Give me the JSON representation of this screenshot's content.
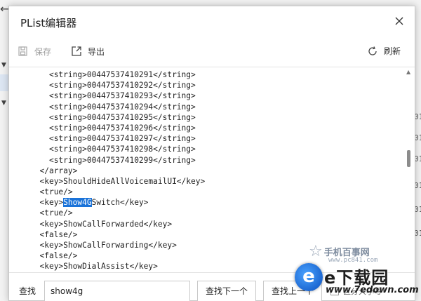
{
  "dialog": {
    "title": "PList编辑器"
  },
  "toolbar": {
    "save_label": "保存",
    "export_label": "导出",
    "refresh_label": "刷新"
  },
  "editor": {
    "lines": [
      {
        "indent": "    ",
        "pre": "<string>00447537410291</string>",
        "hl": "",
        "post": ""
      },
      {
        "indent": "    ",
        "pre": "<string>00447537410292</string>",
        "hl": "",
        "post": ""
      },
      {
        "indent": "    ",
        "pre": "<string>00447537410293</string>",
        "hl": "",
        "post": ""
      },
      {
        "indent": "    ",
        "pre": "<string>00447537410294</string>",
        "hl": "",
        "post": ""
      },
      {
        "indent": "    ",
        "pre": "<string>00447537410295</string>",
        "hl": "",
        "post": ""
      },
      {
        "indent": "    ",
        "pre": "<string>00447537410296</string>",
        "hl": "",
        "post": ""
      },
      {
        "indent": "    ",
        "pre": "<string>00447537410297</string>",
        "hl": "",
        "post": ""
      },
      {
        "indent": "    ",
        "pre": "<string>00447537410298</string>",
        "hl": "",
        "post": ""
      },
      {
        "indent": "    ",
        "pre": "<string>00447537410299</string>",
        "hl": "",
        "post": ""
      },
      {
        "indent": "  ",
        "pre": "</array>",
        "hl": "",
        "post": ""
      },
      {
        "indent": "  ",
        "pre": "<key>ShouldHideAllVoicemailUI</key>",
        "hl": "",
        "post": ""
      },
      {
        "indent": "  ",
        "pre": "<true/>",
        "hl": "",
        "post": ""
      },
      {
        "indent": "  ",
        "pre": "<key>",
        "hl": "Show4G",
        "post": "Switch</key>"
      },
      {
        "indent": "  ",
        "pre": "<true/>",
        "hl": "",
        "post": ""
      },
      {
        "indent": "  ",
        "pre": "<key>ShowCallForwarded</key>",
        "hl": "",
        "post": ""
      },
      {
        "indent": "  ",
        "pre": "<false/>",
        "hl": "",
        "post": ""
      },
      {
        "indent": "  ",
        "pre": "<key>ShowCallForwarding</key>",
        "hl": "",
        "post": ""
      },
      {
        "indent": "  ",
        "pre": "<false/>",
        "hl": "",
        "post": ""
      },
      {
        "indent": "  ",
        "pre": "<key>ShowDialAssist</key>",
        "hl": "",
        "post": ""
      }
    ]
  },
  "find": {
    "label": "查找",
    "value": "show4g",
    "next_label": "查找下一个",
    "prev_label": "查找上一个",
    "case_label": "区分大小写"
  },
  "background": {
    "right_glyphs": [
      "01",
      "01",
      "01",
      "01",
      "01",
      "01"
    ]
  },
  "watermarks": {
    "site1_name": "手机百事网",
    "site1_url": "www.pc841.com",
    "site2_name": "e下载园",
    "site2_logo": "e",
    "site2_url": "www.7edown.com"
  },
  "colors": {
    "highlight": "#1a73d9"
  }
}
